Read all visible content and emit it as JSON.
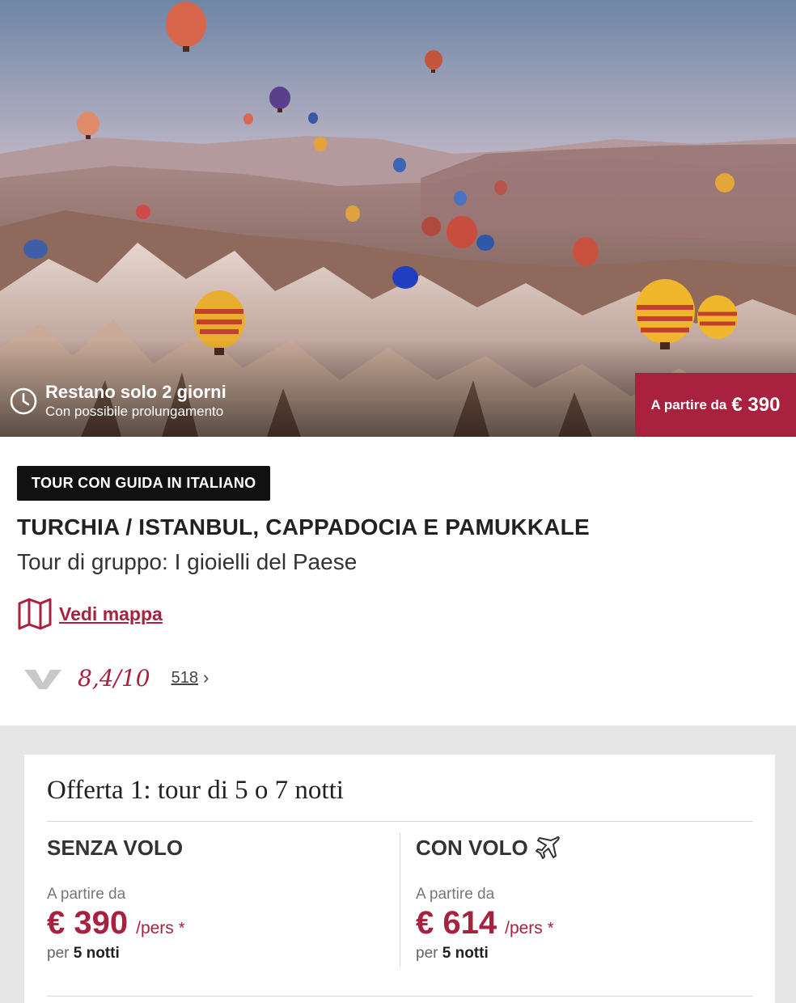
{
  "hero": {
    "countdown_title": "Restano solo 2 giorni",
    "countdown_sub": "Con possibile prolungamento",
    "price_badge_label": "A partire da",
    "price_badge_value": "€ 390"
  },
  "product": {
    "tag": "TOUR CON GUIDA IN ITALIANO",
    "title": "TURCHIA / ISTANBUL, CAPPADOCIA E PAMUKKALE",
    "subtitle": "Tour di gruppo: I gioielli del Paese",
    "map_link": "Vedi mappa",
    "rating_score": "8,4/10",
    "rating_count": "518",
    "rating_chevron": "›"
  },
  "offer": {
    "title": "Offerta 1: tour di 5 o 7 notti",
    "options": [
      {
        "heading": "SENZA VOLO",
        "from_label": "A partire da",
        "price": "€ 390",
        "unit": "/pers",
        "star": "*",
        "per_label": "per",
        "nights": "5 notti"
      },
      {
        "heading": "CON VOLO",
        "from_label": "A partire da",
        "price": "€ 614",
        "unit": "/pers",
        "star": "*",
        "per_label": "per",
        "nights": "5 notti"
      }
    ]
  },
  "colors": {
    "accent": "#a8213f",
    "tag_bg": "#111111",
    "offer_bg": "#e6e6e6"
  },
  "icons": {
    "clock": "clock-icon",
    "map": "map-icon",
    "plane": "plane-icon",
    "rating_logo": "rating-logo-icon"
  }
}
